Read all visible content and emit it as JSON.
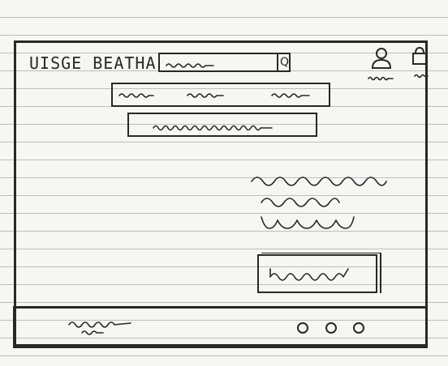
{
  "header": {
    "logo_text": "UISGE BEATHA",
    "search": {
      "placeholder": ""
    },
    "search_icon_glyph": "Q",
    "icons": [
      "user-icon",
      "cart-icon"
    ]
  },
  "nav": {
    "items": [
      "",
      "",
      ""
    ]
  },
  "banner": {
    "text": ""
  },
  "content": {
    "lines": [
      "",
      "",
      ""
    ]
  },
  "cta": {
    "label": ""
  },
  "footer": {
    "text": "",
    "dots": [
      "prev-dot-icon",
      "dot-icon",
      "next-dot-icon"
    ]
  },
  "colors": {
    "ink": "#2a2727",
    "paper": "#f6f6f3",
    "rule": "#bdbdbd"
  }
}
